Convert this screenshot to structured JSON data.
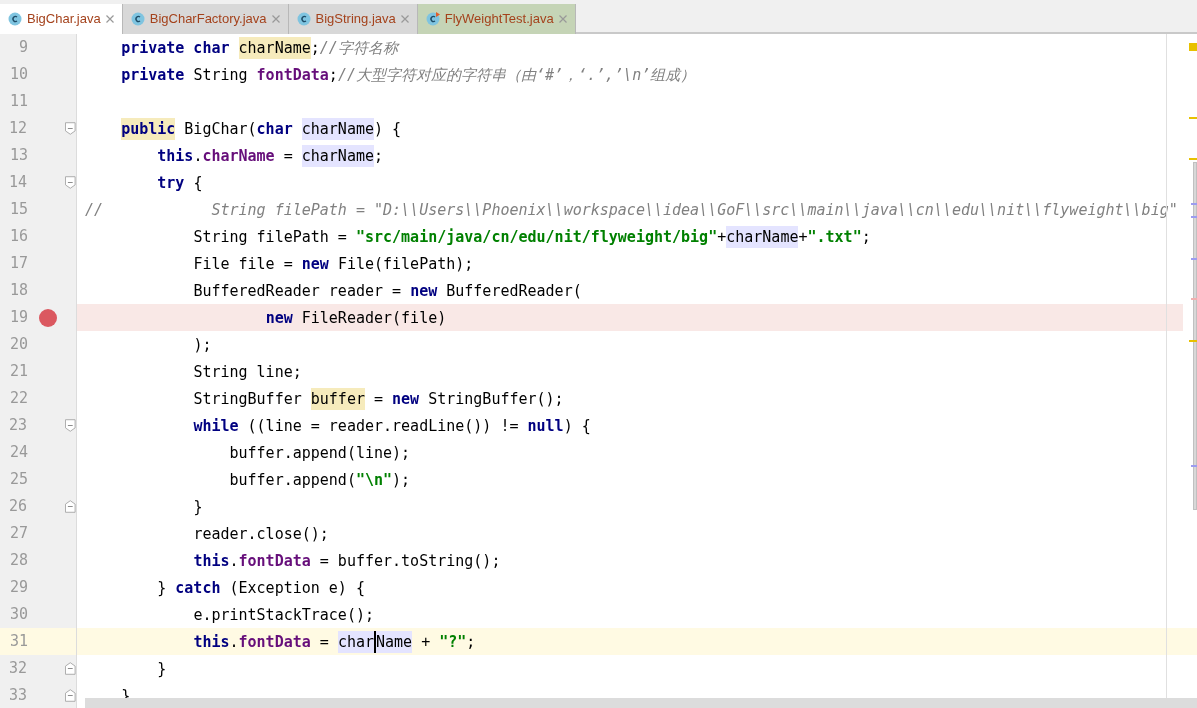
{
  "tabs": [
    {
      "label": "BigChar.java",
      "kind": "class",
      "selected": true
    },
    {
      "label": "BigCharFactory.java",
      "kind": "class",
      "selected": false
    },
    {
      "label": "BigString.java",
      "kind": "class",
      "selected": false
    },
    {
      "label": "FlyWeightTest.java",
      "kind": "test",
      "selected": false
    }
  ],
  "lines": [
    {
      "number": "9",
      "tokens": [
        {
          "kind": "keyword",
          "t": "    private char "
        },
        {
          "kind": "plain",
          "t": "charName",
          "color": "#f6ebbc"
        },
        {
          "kind": "plain",
          "t": ";"
        },
        {
          "kind": "comment",
          "t": "//字符名称"
        }
      ]
    },
    {
      "number": "10",
      "tokens": [
        {
          "kind": "keyword",
          "t": "    private "
        },
        {
          "kind": "plain",
          "t": "String "
        },
        {
          "kind": "field",
          "t": "fontData"
        },
        {
          "kind": "plain",
          "t": ";"
        },
        {
          "kind": "comment",
          "t": "//大型字符对应的字符串（由‘#’，‘.’,’\\n’组成）"
        }
      ]
    },
    {
      "number": "11"
    },
    {
      "number": "12",
      "fold_start": true,
      "tokens": [
        {
          "kind": "keyword",
          "t": "    public",
          "color": "#f6ebbc"
        },
        {
          "kind": "plain",
          "t": " BigChar("
        },
        {
          "kind": "keyword",
          "t": "char "
        },
        {
          "kind": "plain",
          "t": "charName",
          "color": "#e4e4ff"
        },
        {
          "kind": "plain",
          "t": ") {"
        }
      ]
    },
    {
      "number": "13",
      "tokens": [
        {
          "kind": "keyword",
          "t": "        this"
        },
        {
          "kind": "plain",
          "t": "."
        },
        {
          "kind": "field",
          "t": "charName"
        },
        {
          "kind": "plain",
          "t": " = "
        },
        {
          "kind": "plain",
          "t": "charName",
          "color": "#e4e4ff"
        },
        {
          "kind": "plain",
          "t": ";"
        }
      ]
    },
    {
      "number": "14",
      "fold_start": true,
      "tokens": [
        {
          "kind": "keyword",
          "t": "        try"
        },
        {
          "kind": "plain",
          "t": " {"
        }
      ]
    },
    {
      "number": "15",
      "tokens": [
        {
          "kind": "comment",
          "t": "//            String filePath = \"D:\\\\Users\\\\Phoenix\\\\workspace\\\\idea\\\\GoF\\\\src\\\\main\\\\java\\\\cn\\\\edu\\\\nit\\\\flyweight\\\\big\""
        }
      ]
    },
    {
      "number": "16",
      "tokens": [
        {
          "kind": "plain",
          "t": "            String filePath = "
        },
        {
          "kind": "string",
          "t": "\"src/main/java/cn/edu/nit/flyweight/big\""
        },
        {
          "kind": "plain",
          "t": "+"
        },
        {
          "kind": "plain",
          "t": "charName",
          "color": "#e4e4ff"
        },
        {
          "kind": "plain",
          "t": "+"
        },
        {
          "kind": "string",
          "t": "\".txt\""
        },
        {
          "kind": "plain",
          "t": ";"
        }
      ]
    },
    {
      "number": "17",
      "tokens": [
        {
          "kind": "plain",
          "t": "            File file = "
        },
        {
          "kind": "keyword",
          "t": "new"
        },
        {
          "kind": "plain",
          "t": " File(filePath);"
        }
      ]
    },
    {
      "number": "18",
      "tokens": [
        {
          "kind": "plain",
          "t": "            BufferedReader reader = "
        },
        {
          "kind": "keyword",
          "t": "new"
        },
        {
          "kind": "plain",
          "t": " BufferedReader("
        }
      ]
    },
    {
      "number": "19",
      "breakpoint": true,
      "tokens": [
        {
          "kind": "keyword",
          "t": "                    new"
        },
        {
          "kind": "plain",
          "t": " FileReader(file)"
        }
      ]
    },
    {
      "number": "20",
      "tokens": [
        {
          "kind": "plain",
          "t": "            );"
        }
      ]
    },
    {
      "number": "21",
      "tokens": [
        {
          "kind": "plain",
          "t": "            String line;"
        }
      ]
    },
    {
      "number": "22",
      "tokens": [
        {
          "kind": "plain",
          "t": "            StringBuffer "
        },
        {
          "kind": "plain",
          "t": "buffer",
          "color": "#f6ebbc"
        },
        {
          "kind": "plain",
          "t": " = "
        },
        {
          "kind": "keyword",
          "t": "new"
        },
        {
          "kind": "plain",
          "t": " StringBuffer();"
        }
      ]
    },
    {
      "number": "23",
      "fold_start": true,
      "tokens": [
        {
          "kind": "keyword",
          "t": "            while"
        },
        {
          "kind": "plain",
          "t": " ((line = reader.readLine()) != "
        },
        {
          "kind": "keyword",
          "t": "null"
        },
        {
          "kind": "plain",
          "t": ") {"
        }
      ]
    },
    {
      "number": "24",
      "tokens": [
        {
          "kind": "plain",
          "t": "                buffer.append(line);"
        }
      ]
    },
    {
      "number": "25",
      "tokens": [
        {
          "kind": "plain",
          "t": "                buffer.append("
        },
        {
          "kind": "string",
          "t": "\"\\n\""
        },
        {
          "kind": "plain",
          "t": ");"
        }
      ]
    },
    {
      "number": "26",
      "fold_end": true,
      "tokens": [
        {
          "kind": "plain",
          "t": "            }"
        }
      ]
    },
    {
      "number": "27",
      "tokens": [
        {
          "kind": "plain",
          "t": "            reader.close();"
        }
      ]
    },
    {
      "number": "28",
      "tokens": [
        {
          "kind": "keyword",
          "t": "            this"
        },
        {
          "kind": "plain",
          "t": "."
        },
        {
          "kind": "field",
          "t": "fontData"
        },
        {
          "kind": "plain",
          "t": " = buffer.toString();"
        }
      ]
    },
    {
      "number": "29",
      "tokens": [
        {
          "kind": "plain",
          "t": "        } "
        },
        {
          "kind": "keyword",
          "t": "catch"
        },
        {
          "kind": "plain",
          "t": " (Exception e) {"
        }
      ]
    },
    {
      "number": "30",
      "tokens": [
        {
          "kind": "plain",
          "t": "            e.printStackTrace();"
        }
      ]
    },
    {
      "number": "31",
      "current": true,
      "tokens": [
        {
          "kind": "keyword",
          "t": "            this"
        },
        {
          "kind": "plain",
          "t": "."
        },
        {
          "kind": "field",
          "t": "fontData"
        },
        {
          "kind": "plain",
          "t": " = "
        },
        {
          "kind": "plain",
          "t": "char",
          "color": "#e4e4ff"
        },
        {
          "kind": "plain",
          "t": "Name",
          "color": "#e4e4ff",
          "caret": true
        },
        {
          "kind": "plain",
          "t": " + "
        },
        {
          "kind": "string",
          "t": "\"?\""
        },
        {
          "kind": "plain",
          "t": ";"
        }
      ]
    },
    {
      "number": "32",
      "fold_end": true,
      "tokens": [
        {
          "kind": "plain",
          "t": "        }"
        }
      ]
    },
    {
      "number": "33",
      "fold_end": true,
      "tokens": [
        {
          "kind": "plain",
          "t": "    }"
        }
      ]
    }
  ]
}
